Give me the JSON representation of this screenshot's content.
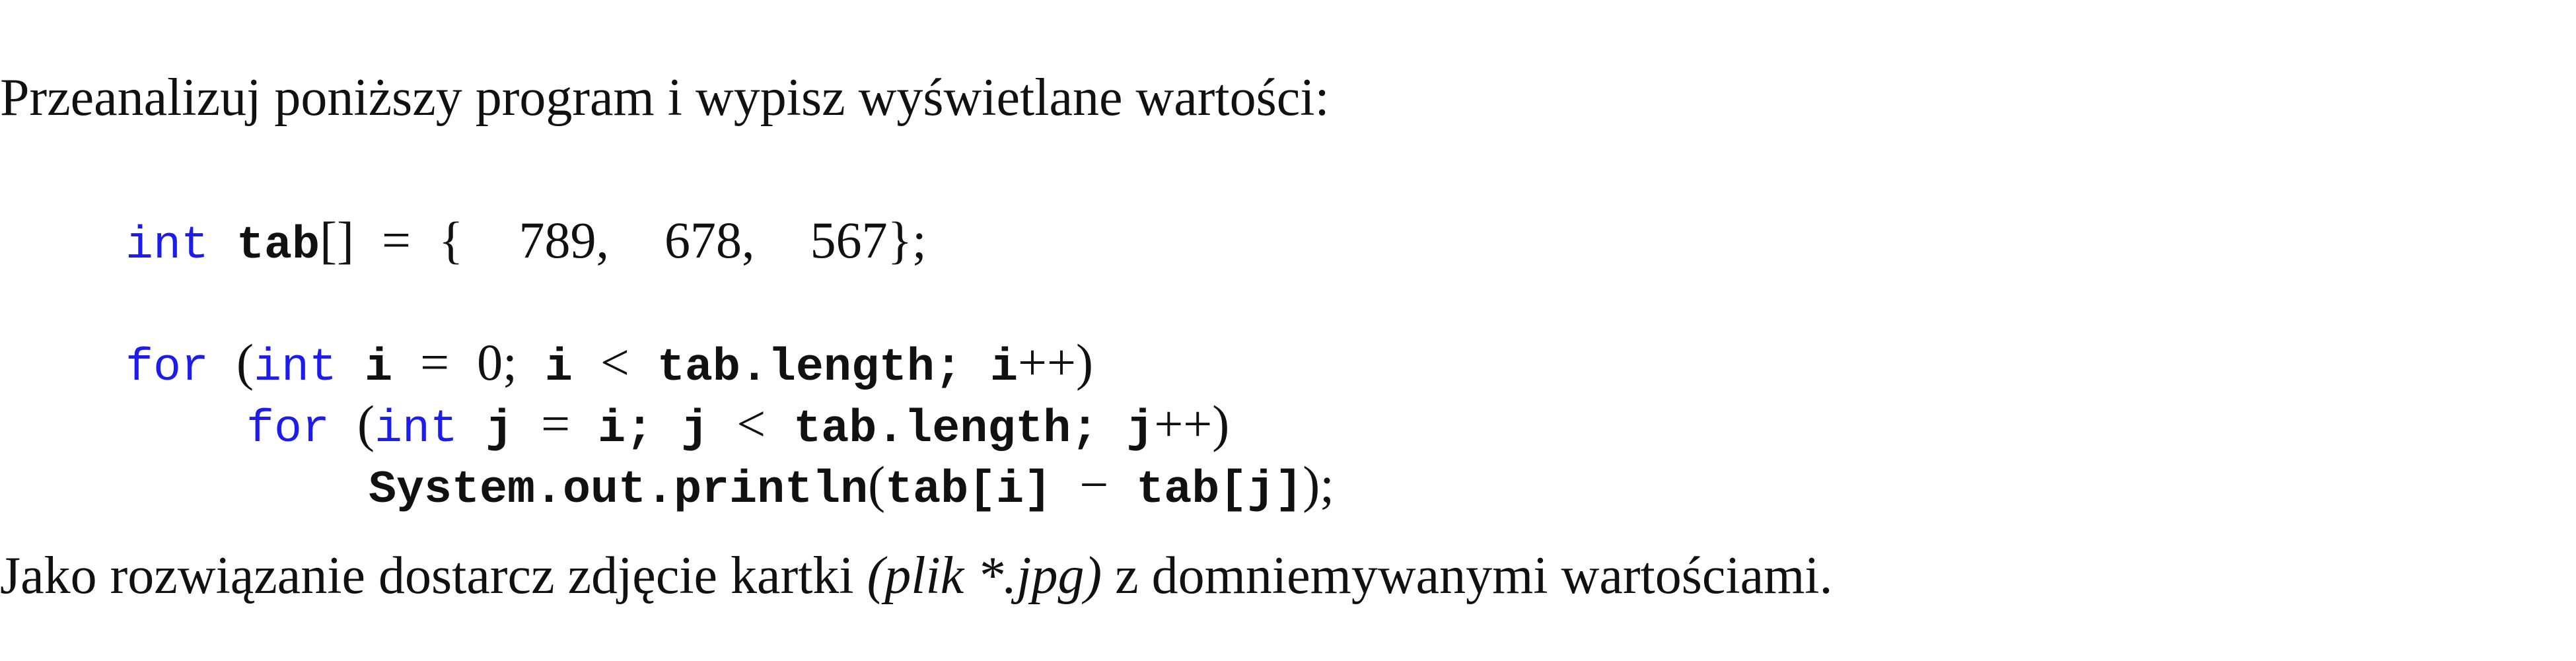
{
  "intro_text": "Przeanalizuj poniższy program i wypisz wyświetlane wartości:",
  "code": {
    "line1": {
      "kw_int": "int",
      "id_tab": "tab",
      "brackets": "[]",
      "equals": "=",
      "brace_open": "{",
      "v1": "789,",
      "v2": "678,",
      "v3": "567",
      "brace_close": "};"
    },
    "line2": {
      "kw_for": "for",
      "paren_open": "(",
      "kw_int": "int",
      "id_i": "i",
      "equals": "=",
      "zero": "0;",
      "id_i2": "i",
      "lt": "<",
      "id_tab_length": "tab.length;",
      "id_i_inc": "i",
      "inc_paren": "++)"
    },
    "line3": {
      "kw_for": "for",
      "paren_open": "(",
      "kw_int": "int",
      "id_j": "j",
      "equals": "=",
      "id_i_semi": "i;",
      "id_j2": "j",
      "lt": "<",
      "id_tab_length": "tab.length;",
      "id_j_inc": "j",
      "inc_paren": "++)"
    },
    "line4": {
      "id_println": "System.out.println",
      "paren_open": "(",
      "id_tab_i": "tab",
      "bracket_i": "[i]",
      "minus": "−",
      "id_tab_j": "tab",
      "bracket_j": "[j]",
      "paren_close": ");"
    }
  },
  "outro": {
    "before": "Jako rozwiązanie dostarcz zdjęcie kartki ",
    "emph": "(plik *.jpg)",
    "after": " z domniemywanymi wartościami."
  },
  "colors": {
    "keyword": "#1c1cf0",
    "text": "#111111"
  }
}
